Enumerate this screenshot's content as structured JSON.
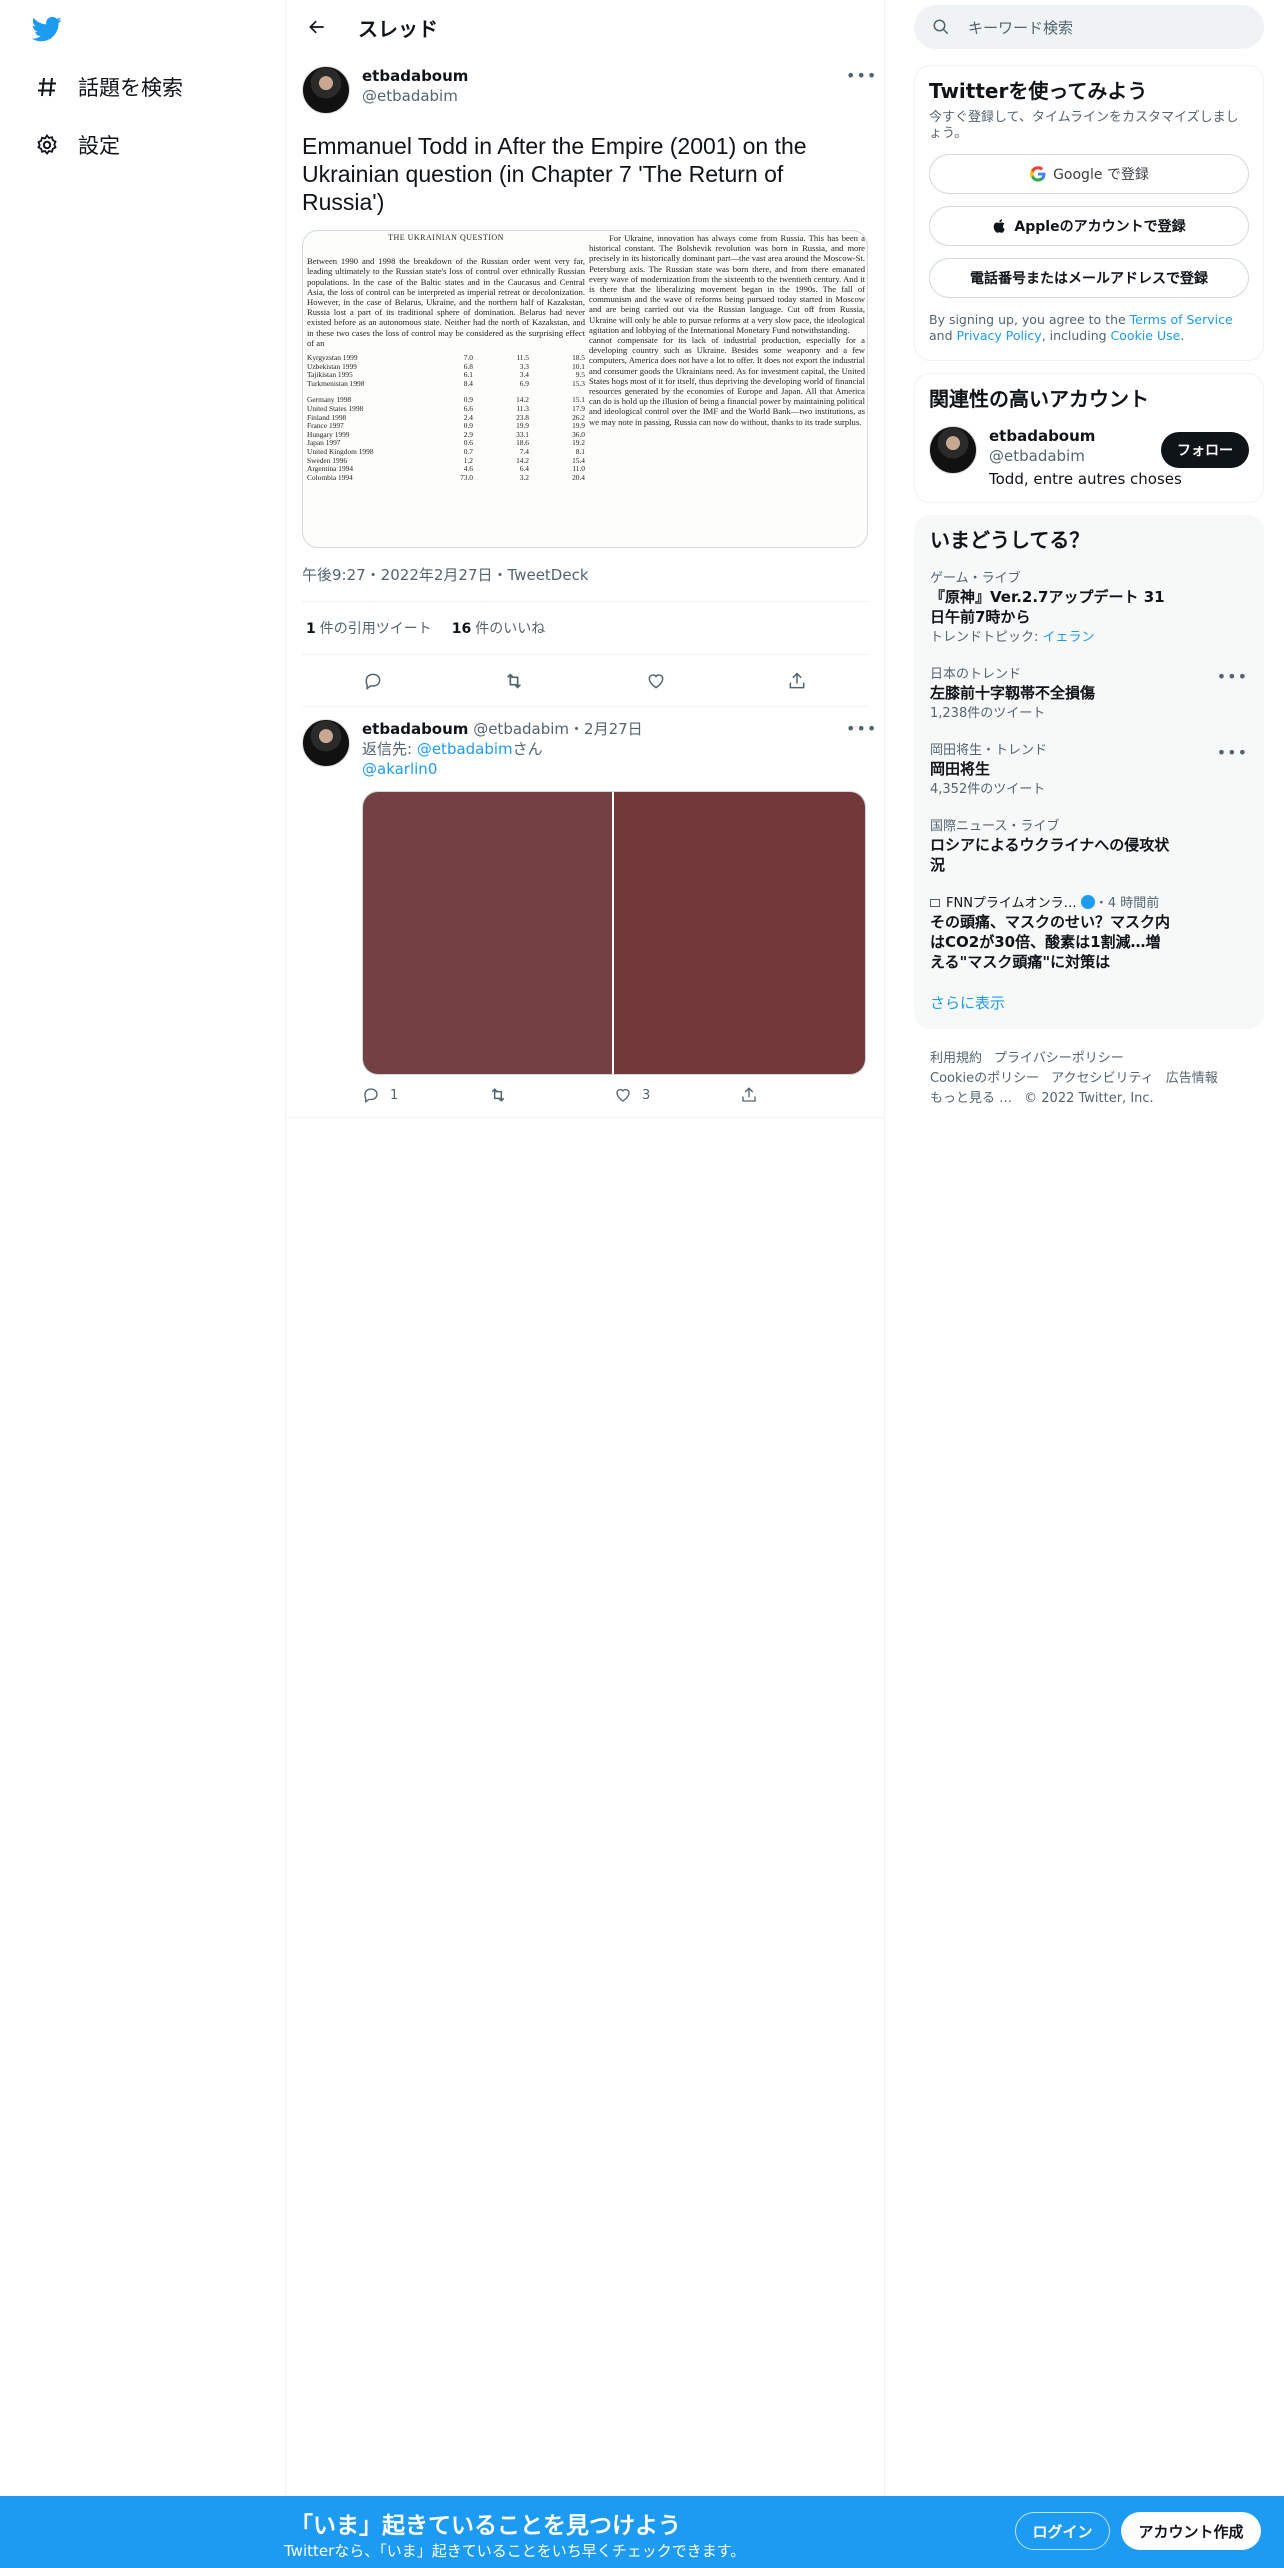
{
  "nav": {
    "items": [
      {
        "label": "話題を検索",
        "icon": "hashtag-icon"
      },
      {
        "label": "設定",
        "icon": "gear-icon"
      }
    ]
  },
  "header": {
    "title": "スレッド"
  },
  "tweet": {
    "name": "etbadaboum",
    "handle": "@etbadabim",
    "text": "Emmanuel Todd in After the Empire (2001) on the Ukrainian question (in Chapter 7 'The Return of Russia')",
    "image": {
      "heading": "THE UKRAINIAN QUESTION",
      "left_para": "Between 1990 and 1998 the breakdown of the Russian order went very far, leading ultimately to the Russian state's loss of control over ethnically Russian populations. In the case of the Baltic states and in the Caucasus and Central Asia, the loss of control can be interpreted as imperial retreat or decolonization. However, in the case of Belarus, Ukraine, and the northern half of Kazakstan, Russia lost a part of its traditional sphere of domination. Belarus had never existed before as an autonomous state. Neither had the north of Kazakstan, and in these two cases the loss of control may be considered as the surprising effect of an",
      "table_a": [
        [
          "Kyrgyzstan 1999",
          "7.0",
          "11.5",
          "18.5"
        ],
        [
          "Uzbekistan 1999",
          "6.8",
          "3.3",
          "10.1"
        ],
        [
          "Tajikistan 1995",
          "6.1",
          "3.4",
          "9.5"
        ],
        [
          "Turkmenistan 1998",
          "8.4",
          "6.9",
          "15.3"
        ]
      ],
      "table_b": [
        [
          "Germany 1998",
          "0.9",
          "14.2",
          "15.1"
        ],
        [
          "United States 1998",
          "6.6",
          "11.3",
          "17.9"
        ],
        [
          "Finland 1998",
          "2.4",
          "23.8",
          "26.2"
        ],
        [
          "France 1997",
          "0.9",
          "19.9",
          "19.9"
        ],
        [
          "Hungary 1999",
          "2.9",
          "33.1",
          "36.0"
        ],
        [
          "Japan 1997",
          "0.6",
          "18.6",
          "19.2"
        ],
        [
          "United Kingdom 1998",
          "0.7",
          "7.4",
          "8.1"
        ],
        [
          "Sweden 1996",
          "1.2",
          "14.2",
          "15.4"
        ],
        [
          "Argentina 1994",
          "4.6",
          "6.4",
          "11.0"
        ],
        [
          "Colombia 1994",
          "73.0",
          "3.2",
          "20.4"
        ]
      ],
      "right_para_1": "For Ukraine, innovation has always come from Russia. This has been a historical constant. The Bolshevik revolution was born in Russia, and more precisely in its historically dominant part—the vast area around the Moscow-St. Petersburg axis. The Russian state was born there, and from there emanated every wave of modernization from the sixteenth to the twentieth century. And it is there that the liberalizing movement began in the 1990s. The fall of communism and the wave of reforms being pursued today started in Moscow and are being carried out via the Russian language. Cut off from Russia, Ukraine will only be able to pursue reforms at a very slow pace, the ideological agitation and lobbying of the International Monetary Fund notwithstanding.",
      "right_para_2": "cannot compensate for its lack of industrial production, especially for a developing country such as Ukraine. Besides some weaponry and a few computers, America does not have a lot to offer. It does not export the industrial and consumer goods the Ukrainians need. As for investment capital, the United States hogs most of it for itself, thus depriving the developing world of financial resources generated by the economies of Europe and Japan. All that America can do is hold up the illusion of being a financial power by maintaining political and ideological control over the IMF and the World Bank—two institutions, as we may note in passing, Russia can now do without, thanks to its trade surplus."
    },
    "time": "午後9:27・2022年2月27日",
    "sep": "・",
    "client": "TweetDeck",
    "quote_count": "1",
    "quote_label": "件の引用ツイート",
    "like_count": "16",
    "like_label": "件のいいね"
  },
  "reply": {
    "name": "etbadaboum",
    "handle": "@etbadabim",
    "date": "・2月27日",
    "reply_prefix": "返信先: ",
    "reply_to": "@etbadabim",
    "reply_suffix": "さん",
    "mention": "@akarlin0",
    "media_colors": [
      "#744142",
      "#73393a"
    ],
    "reply_count": "1",
    "retweet_count": "",
    "like_count": "3"
  },
  "right": {
    "search_placeholder": "キーワード検索",
    "signup": {
      "title": "Twitterを使ってみよう",
      "subtitle": "今すぐ登録して、タイムラインをカスタマイズしましょう。",
      "google": "Google で登録",
      "apple": "Appleのアカウントで登録",
      "phone": "電話番号またはメールアドレスで登録",
      "legal_1": "By signing up, you agree to the ",
      "terms": "Terms of Service",
      "legal_2": " and ",
      "privacy": "Privacy Policy",
      "legal_3": ", including ",
      "cookie": "Cookie Use",
      "legal_4": "."
    },
    "related": {
      "title": "関連性の高いアカウント",
      "name": "etbadaboum",
      "handle": "@etbadabim",
      "bio": "Todd, entre autres choses",
      "follow": "フォロー"
    },
    "trends": {
      "title": "いまどうしてる？",
      "items": [
        {
          "ctx": "ゲーム・ライブ",
          "topic": "『原神』Ver.2.7アップデート 31日午前7時から",
          "cnt_prefix": "トレンドトピック: ",
          "cnt_link": "イェラン"
        },
        {
          "ctx": "日本のトレンド",
          "topic": "左膝前十字靱帯不全損傷",
          "cnt": "1,238件のツイート"
        },
        {
          "ctx": "岡田将生・トレンド",
          "topic": "岡田将生",
          "cnt": "4,352件のツイート"
        },
        {
          "ctx": "国際ニュース・ライブ",
          "topic": "ロシアによるウクライナへの侵攻状況"
        },
        {
          "ctx_source": "FNNプライムオンラ…",
          "ctx_time": "・4 時間前",
          "topic": "その頭痛、マスクのせい？マスク内はCO2が30倍、酸素は1割減…増える\"マスク頭痛\"に対策は"
        }
      ],
      "show_more": "さらに表示"
    },
    "footer": {
      "links": [
        "利用規約",
        "プライバシーポリシー",
        "Cookieのポリシー",
        "アクセシビリティ",
        "広告情報",
        "もっと見る …"
      ],
      "copyright": "© 2022 Twitter, Inc."
    }
  },
  "bottom": {
    "title": "「いま」起きていることを見つけよう",
    "subtitle": "Twitterなら、「いま」起きていることをいち早くチェックできます。",
    "login": "ログイン",
    "signup": "アカウント作成"
  },
  "colors": {
    "accent": "#1d9bf0",
    "text": "#0f1419",
    "muted": "#536471"
  }
}
